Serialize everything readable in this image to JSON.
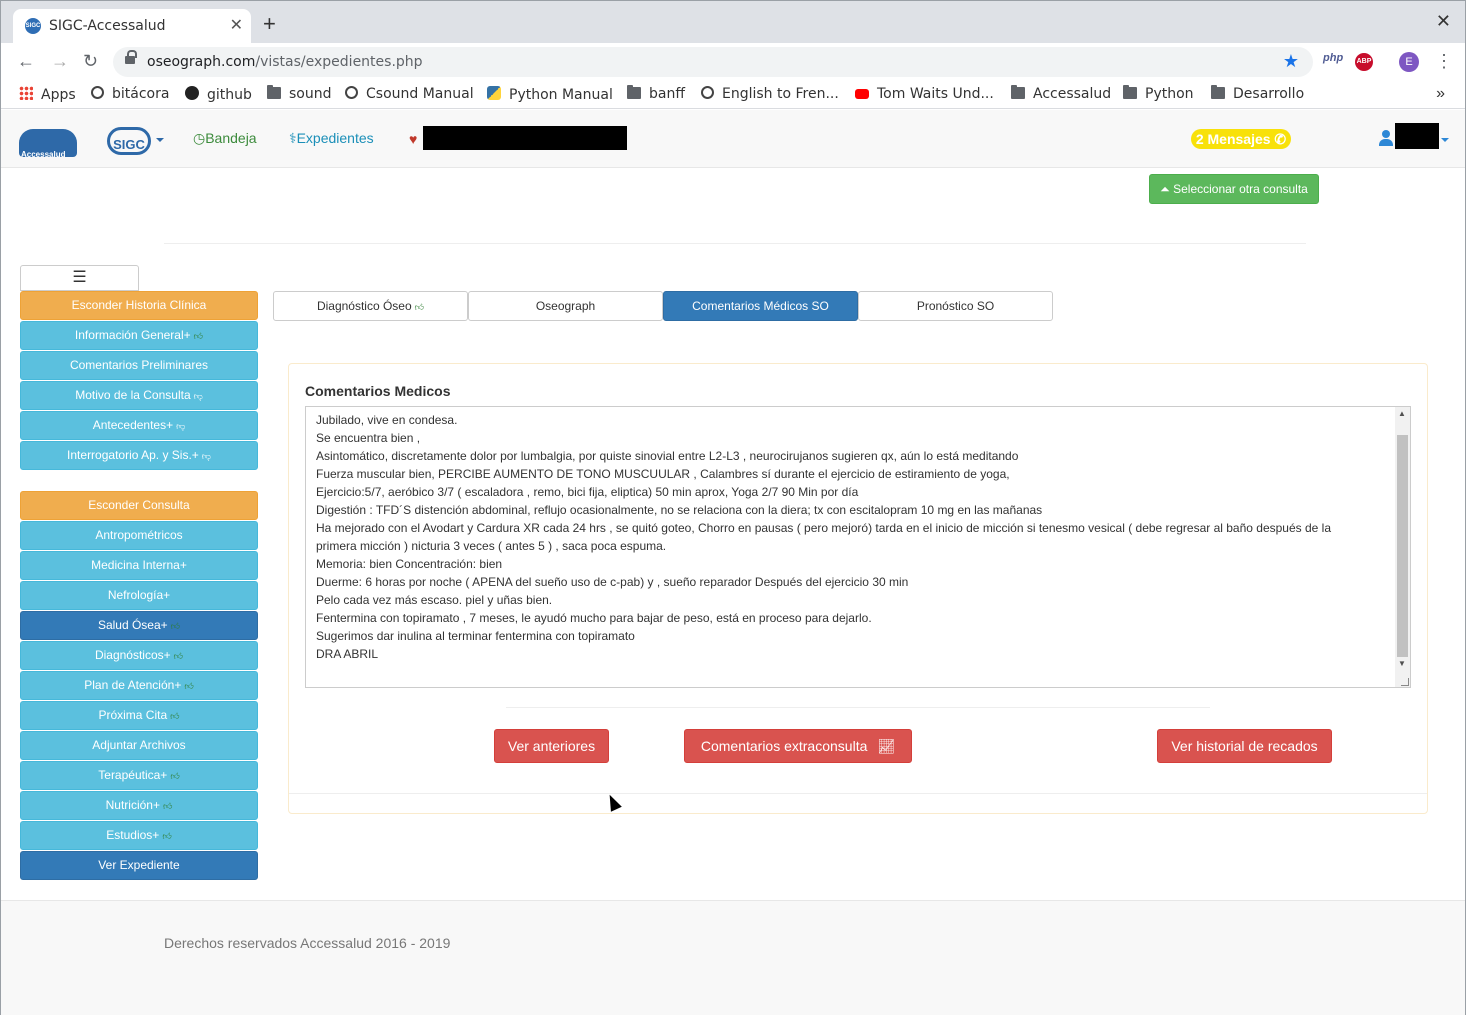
{
  "browser": {
    "tab_title": "SIGC-Accessalud",
    "tab_favicon_text": "SIGC",
    "url_host": "oseograph.com",
    "url_path": "/vistas/expedientes.php",
    "profile_initial": "E",
    "ext_php": "php",
    "ext_abp": "ABP",
    "bookmarks": [
      {
        "label": "Apps",
        "icon": "apps-icon"
      },
      {
        "label": "bitácora",
        "icon": "globe-icon"
      },
      {
        "label": "github",
        "icon": "github-icon"
      },
      {
        "label": "sound",
        "icon": "folder-icon"
      },
      {
        "label": "Csound Manual",
        "icon": "globe-icon"
      },
      {
        "label": "Python Manual",
        "icon": "python-icon"
      },
      {
        "label": "banff",
        "icon": "folder-icon"
      },
      {
        "label": "English to Fren...",
        "icon": "globe-icon"
      },
      {
        "label": "Tom Waits Und...",
        "icon": "youtube-icon"
      },
      {
        "label": "Accessalud",
        "icon": "folder-icon"
      },
      {
        "label": "Python",
        "icon": "folder-icon"
      },
      {
        "label": "Desarrollo",
        "icon": "folder-icon"
      }
    ]
  },
  "navbar": {
    "logo_text": "Accessalud",
    "sigc_text": "SIGC",
    "bandeja": "Bandeja",
    "expedientes": "Expedientes",
    "mensajes": "2 Mensajes"
  },
  "main": {
    "seleccionar_button": "Seleccionar otra consulta",
    "sidebar": [
      {
        "label": "Esconder Historia Clínica",
        "style": "orange",
        "thumb": ""
      },
      {
        "label": "Información General+",
        "style": "info",
        "thumb": "up"
      },
      {
        "label": "Comentarios Preliminares",
        "style": "info",
        "thumb": ""
      },
      {
        "label": "Motivo de la Consulta",
        "style": "info",
        "thumb": "down"
      },
      {
        "label": "Antecedentes+",
        "style": "info",
        "thumb": "down"
      },
      {
        "label": "Interrogatorio Ap. y Sis.+",
        "style": "info",
        "thumb": "down"
      },
      {
        "label": "Esconder Consulta",
        "style": "orange",
        "thumb": ""
      },
      {
        "label": "Antropométricos",
        "style": "info",
        "thumb": ""
      },
      {
        "label": "Medicina Interna+",
        "style": "info",
        "thumb": ""
      },
      {
        "label": "Nefrología+",
        "style": "info",
        "thumb": ""
      },
      {
        "label": "Salud Ósea+",
        "style": "dark",
        "thumb": "up"
      },
      {
        "label": "Diagnósticos+",
        "style": "info",
        "thumb": "up"
      },
      {
        "label": "Plan de Atención+",
        "style": "info",
        "thumb": "up"
      },
      {
        "label": "Próxima Cita",
        "style": "info",
        "thumb": "up"
      },
      {
        "label": "Adjuntar Archivos",
        "style": "info",
        "thumb": ""
      },
      {
        "label": "Terapéutica+",
        "style": "info",
        "thumb": "up"
      },
      {
        "label": "Nutrición+",
        "style": "info",
        "thumb": "up"
      },
      {
        "label": "Estudios+",
        "style": "info",
        "thumb": "up"
      },
      {
        "label": "Ver Expediente",
        "style": "dark",
        "thumb": ""
      }
    ],
    "tabs": [
      {
        "label": "Diagnóstico Óseo",
        "thumb": "up",
        "active": false
      },
      {
        "label": "Oseograph",
        "thumb": "",
        "active": false
      },
      {
        "label": "Comentarios Médicos SO",
        "thumb": "",
        "active": true
      },
      {
        "label": "Pronóstico SO",
        "thumb": "",
        "active": false
      }
    ],
    "panel_title": "Comentarios Medicos",
    "comment_lines": [
      "Jubilado, vive en condesa.",
      "Se encuentra bien ,",
      "Asintomático, discretamente dolor por lumbalgia, por quiste sinovial entre L2-L3 , neurocirujanos sugieren qx, aún lo está meditando",
      "Fuerza muscular bien, PERCIBE AUMENTO DE TONO MUSCUULAR , Calambres sí durante el ejercicio de estiramiento de yoga,",
      "Ejercicio:5/7, aeróbico 3/7 ( escaladora , remo, bici fija, eliptica) 50 min aprox, Yoga 2/7 90 Min por día",
      "Digestión : TFD´S distención abdominal, reflujo ocasionalmente, no se relaciona con la diera; tx con escitalopram 10 mg en las mañanas",
      "Ha mejorado con el Avodart y Cardura XR cada 24 hrs , se quitó goteo, Chorro en pausas ( pero mejoró) tarda en el inicio de micción si tenesmo vesical ( debe regresar al baño después de la",
      "primera micción ) nicturia 3 veces ( antes 5 ) , saca poca espuma.",
      "Memoria: bien Concentración:  bien",
      "Duerme: 6 horas por noche ( APENA del sueño uso de c-pab)  y , sueño reparador Después del ejercicio 30 min",
      "Pelo cada vez más escaso. piel y uñas bien.",
      "Fentermina con topiramato , 7 meses, le ayudó mucho para bajar de peso, está en proceso para dejarlo.",
      "Sugerimos dar inulina al terminar fentermina con topiramato",
      "DRA ABRIL"
    ],
    "btn_anteriores": "Ver anteriores",
    "btn_extraconsulta": "Comentarios extraconsulta",
    "btn_recados": "Ver historial de recados"
  },
  "footer": {
    "text": "Derechos reservados Accessalud 2016 - 2019"
  },
  "colors": {
    "info": "#5bc0de",
    "warning": "#f0ad4e",
    "primary": "#337ab7",
    "danger": "#d9534f",
    "success": "#5cb85c"
  }
}
